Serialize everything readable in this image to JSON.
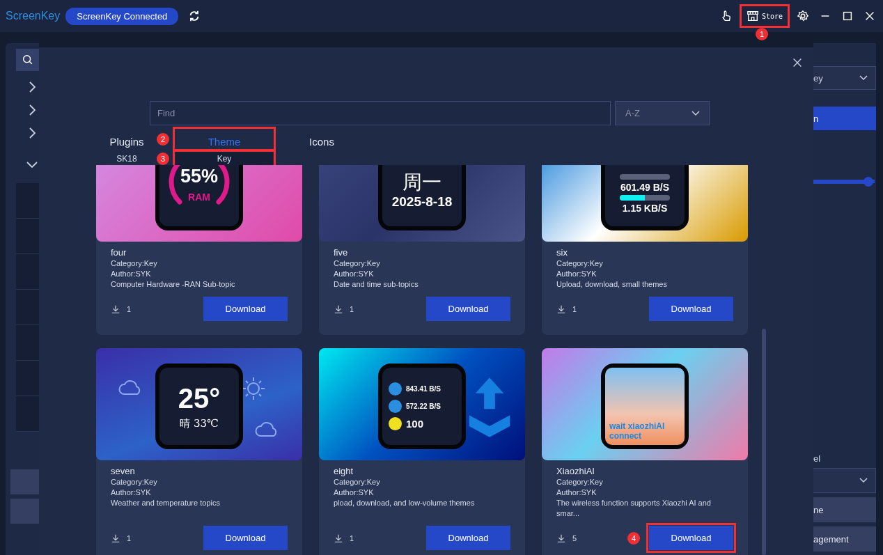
{
  "titlebar": {
    "app_name": "ScreenKey",
    "status": "ScreenKey Connected",
    "store_label": "Store"
  },
  "background_right": {
    "dropdown_value": "ey",
    "button_label": "n",
    "slider": {
      "level": 0.97
    },
    "field_label": "el",
    "buttons": [
      "ne",
      "agement"
    ]
  },
  "store": {
    "search": {
      "placeholder": "Find"
    },
    "sort": {
      "value": "A-Z"
    },
    "tabs": [
      {
        "label": "Plugins",
        "selected": false
      },
      {
        "label": "Theme",
        "selected": true
      },
      {
        "label": "Icons",
        "selected": false
      }
    ],
    "subtabs": [
      {
        "label": "SK18",
        "selected": false
      },
      {
        "label": "Key",
        "selected": true
      }
    ],
    "themes": [
      {
        "name": "four",
        "category": "Category:Key",
        "author": "Author:SYK",
        "description": "Computer Hardware -RAN Sub-topic",
        "downloads": "1",
        "button": "Download",
        "preview": {
          "kind": "ram",
          "lines": [
            "55%",
            "RAM"
          ]
        }
      },
      {
        "name": "five",
        "category": "Category:Key",
        "author": "Author:SYK",
        "description": "Date and time sub-topics",
        "downloads": "1",
        "button": "Download",
        "preview": {
          "kind": "date",
          "lines": [
            "周一",
            "2025-8-18"
          ]
        }
      },
      {
        "name": "six",
        "category": "Category:Key",
        "author": "Author:SYK",
        "description": "Upload, download, small themes",
        "downloads": "1",
        "button": "Download",
        "preview": {
          "kind": "speed",
          "lines": [
            "601.49 B/S",
            "1.15 KB/S"
          ]
        }
      },
      {
        "name": "seven",
        "category": "Category:Key",
        "author": "Author:SYK",
        "description": "Weather and temperature topics",
        "downloads": "1",
        "button": "Download",
        "preview": {
          "kind": "weather",
          "lines": [
            "25°",
            "晴 33℃"
          ]
        }
      },
      {
        "name": "eight",
        "category": "Category:Key",
        "author": "Author:SYK",
        "description": "pload, download, and low-volume themes",
        "downloads": "1",
        "button": "Download",
        "preview": {
          "kind": "network",
          "lines": [
            "843.41 B/S",
            "572.22 B/S",
            "100"
          ]
        }
      },
      {
        "name": "XiaozhiAI",
        "category": "Category:Key",
        "author": "Author:SYK",
        "description": "The wireless function supports Xiaozhi AI and smar...",
        "downloads": "5",
        "button": "Download",
        "preview": {
          "kind": "avatar",
          "lines": [
            "wait xiaozhiAI",
            "connect"
          ]
        }
      }
    ]
  },
  "annotations": [
    {
      "number": "1"
    },
    {
      "number": "2"
    },
    {
      "number": "3"
    },
    {
      "number": "4"
    }
  ]
}
